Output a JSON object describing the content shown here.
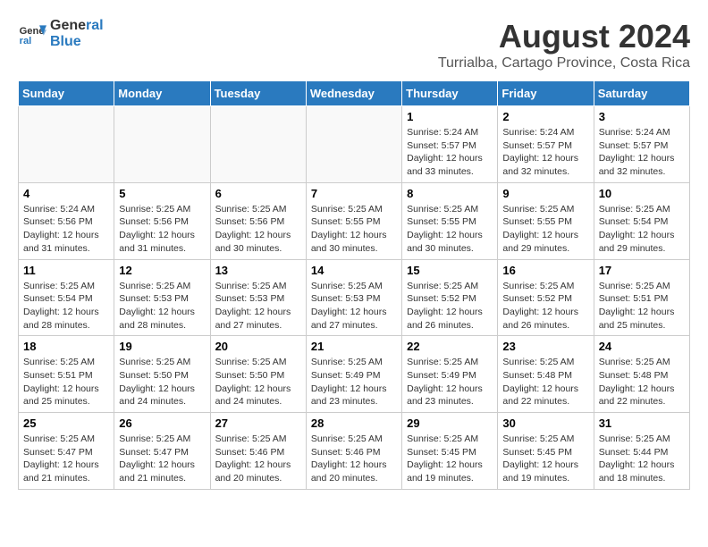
{
  "header": {
    "logo_line1": "General",
    "logo_line2": "Blue",
    "month_year": "August 2024",
    "location": "Turrialba, Cartago Province, Costa Rica"
  },
  "weekdays": [
    "Sunday",
    "Monday",
    "Tuesday",
    "Wednesday",
    "Thursday",
    "Friday",
    "Saturday"
  ],
  "weeks": [
    [
      {
        "day": "",
        "info": ""
      },
      {
        "day": "",
        "info": ""
      },
      {
        "day": "",
        "info": ""
      },
      {
        "day": "",
        "info": ""
      },
      {
        "day": "1",
        "info": "Sunrise: 5:24 AM\nSunset: 5:57 PM\nDaylight: 12 hours\nand 33 minutes."
      },
      {
        "day": "2",
        "info": "Sunrise: 5:24 AM\nSunset: 5:57 PM\nDaylight: 12 hours\nand 32 minutes."
      },
      {
        "day": "3",
        "info": "Sunrise: 5:24 AM\nSunset: 5:57 PM\nDaylight: 12 hours\nand 32 minutes."
      }
    ],
    [
      {
        "day": "4",
        "info": "Sunrise: 5:24 AM\nSunset: 5:56 PM\nDaylight: 12 hours\nand 31 minutes."
      },
      {
        "day": "5",
        "info": "Sunrise: 5:25 AM\nSunset: 5:56 PM\nDaylight: 12 hours\nand 31 minutes."
      },
      {
        "day": "6",
        "info": "Sunrise: 5:25 AM\nSunset: 5:56 PM\nDaylight: 12 hours\nand 30 minutes."
      },
      {
        "day": "7",
        "info": "Sunrise: 5:25 AM\nSunset: 5:55 PM\nDaylight: 12 hours\nand 30 minutes."
      },
      {
        "day": "8",
        "info": "Sunrise: 5:25 AM\nSunset: 5:55 PM\nDaylight: 12 hours\nand 30 minutes."
      },
      {
        "day": "9",
        "info": "Sunrise: 5:25 AM\nSunset: 5:55 PM\nDaylight: 12 hours\nand 29 minutes."
      },
      {
        "day": "10",
        "info": "Sunrise: 5:25 AM\nSunset: 5:54 PM\nDaylight: 12 hours\nand 29 minutes."
      }
    ],
    [
      {
        "day": "11",
        "info": "Sunrise: 5:25 AM\nSunset: 5:54 PM\nDaylight: 12 hours\nand 28 minutes."
      },
      {
        "day": "12",
        "info": "Sunrise: 5:25 AM\nSunset: 5:53 PM\nDaylight: 12 hours\nand 28 minutes."
      },
      {
        "day": "13",
        "info": "Sunrise: 5:25 AM\nSunset: 5:53 PM\nDaylight: 12 hours\nand 27 minutes."
      },
      {
        "day": "14",
        "info": "Sunrise: 5:25 AM\nSunset: 5:53 PM\nDaylight: 12 hours\nand 27 minutes."
      },
      {
        "day": "15",
        "info": "Sunrise: 5:25 AM\nSunset: 5:52 PM\nDaylight: 12 hours\nand 26 minutes."
      },
      {
        "day": "16",
        "info": "Sunrise: 5:25 AM\nSunset: 5:52 PM\nDaylight: 12 hours\nand 26 minutes."
      },
      {
        "day": "17",
        "info": "Sunrise: 5:25 AM\nSunset: 5:51 PM\nDaylight: 12 hours\nand 25 minutes."
      }
    ],
    [
      {
        "day": "18",
        "info": "Sunrise: 5:25 AM\nSunset: 5:51 PM\nDaylight: 12 hours\nand 25 minutes."
      },
      {
        "day": "19",
        "info": "Sunrise: 5:25 AM\nSunset: 5:50 PM\nDaylight: 12 hours\nand 24 minutes."
      },
      {
        "day": "20",
        "info": "Sunrise: 5:25 AM\nSunset: 5:50 PM\nDaylight: 12 hours\nand 24 minutes."
      },
      {
        "day": "21",
        "info": "Sunrise: 5:25 AM\nSunset: 5:49 PM\nDaylight: 12 hours\nand 23 minutes."
      },
      {
        "day": "22",
        "info": "Sunrise: 5:25 AM\nSunset: 5:49 PM\nDaylight: 12 hours\nand 23 minutes."
      },
      {
        "day": "23",
        "info": "Sunrise: 5:25 AM\nSunset: 5:48 PM\nDaylight: 12 hours\nand 22 minutes."
      },
      {
        "day": "24",
        "info": "Sunrise: 5:25 AM\nSunset: 5:48 PM\nDaylight: 12 hours\nand 22 minutes."
      }
    ],
    [
      {
        "day": "25",
        "info": "Sunrise: 5:25 AM\nSunset: 5:47 PM\nDaylight: 12 hours\nand 21 minutes."
      },
      {
        "day": "26",
        "info": "Sunrise: 5:25 AM\nSunset: 5:47 PM\nDaylight: 12 hours\nand 21 minutes."
      },
      {
        "day": "27",
        "info": "Sunrise: 5:25 AM\nSunset: 5:46 PM\nDaylight: 12 hours\nand 20 minutes."
      },
      {
        "day": "28",
        "info": "Sunrise: 5:25 AM\nSunset: 5:46 PM\nDaylight: 12 hours\nand 20 minutes."
      },
      {
        "day": "29",
        "info": "Sunrise: 5:25 AM\nSunset: 5:45 PM\nDaylight: 12 hours\nand 19 minutes."
      },
      {
        "day": "30",
        "info": "Sunrise: 5:25 AM\nSunset: 5:45 PM\nDaylight: 12 hours\nand 19 minutes."
      },
      {
        "day": "31",
        "info": "Sunrise: 5:25 AM\nSunset: 5:44 PM\nDaylight: 12 hours\nand 18 minutes."
      }
    ]
  ]
}
